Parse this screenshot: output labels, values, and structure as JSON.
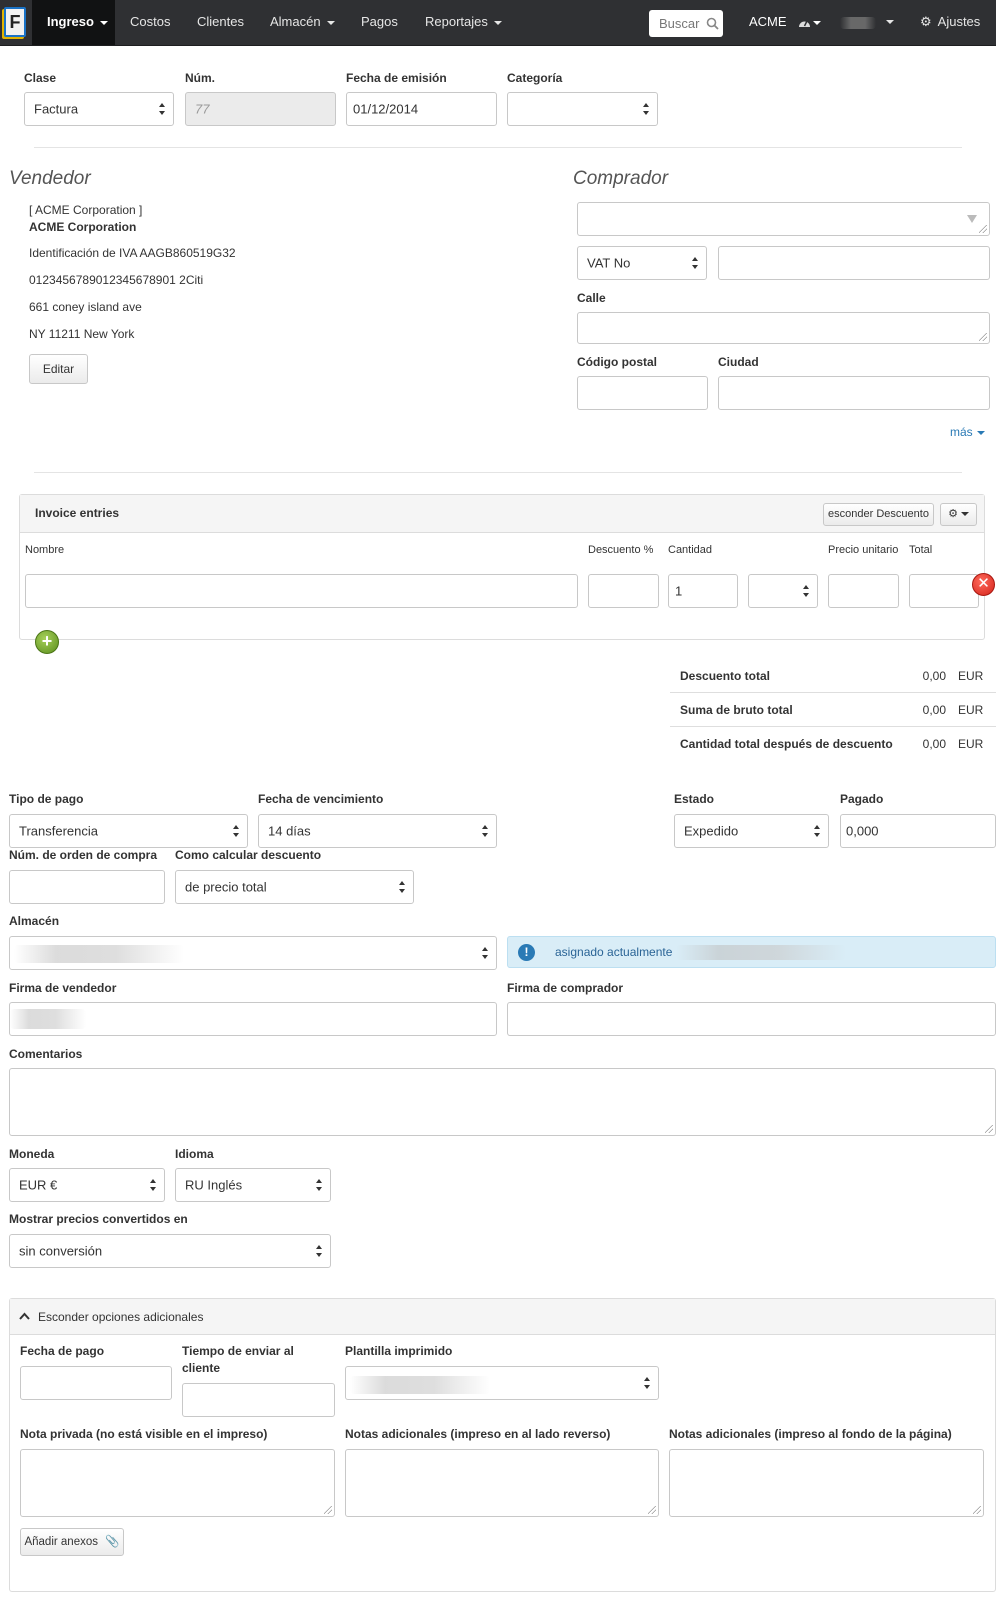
{
  "navbar": {
    "logo_letter": "F",
    "items": [
      {
        "label": "Ingreso"
      },
      {
        "label": "Costos"
      },
      {
        "label": "Clientes"
      },
      {
        "label": "Almacén"
      },
      {
        "label": "Pagos"
      },
      {
        "label": "Reportajes"
      }
    ],
    "search_placeholder": "Buscar",
    "company": "ACME",
    "settings": "Ajustes"
  },
  "header_form": {
    "clase_label": "Clase",
    "clase_value": "Factura",
    "num_label": "Núm.",
    "num_placeholder": "77",
    "fecha_label": "Fecha de emisión",
    "fecha_value": "01/12/2014",
    "categoria_label": "Categoría"
  },
  "vendedor": {
    "heading": "Vendedor",
    "bracket_name": "[ ACME Corporation ]",
    "name": "ACME Corporation",
    "vat": "Identificación de IVA AAGB860519G32",
    "bank": "0123456789012345678901 2Citi",
    "street": "661 coney island ave",
    "city": "NY 11211 New York",
    "edit_label": "Editar"
  },
  "comprador": {
    "heading": "Comprador",
    "vat_select": "VAT No",
    "calle_label": "Calle",
    "cp_label": "Código postal",
    "ciudad_label": "Ciudad",
    "more_label": "más"
  },
  "entries": {
    "title": "Invoice entries",
    "hide_discount": "esconder Descuento",
    "col_nombre": "Nombre",
    "col_descuento": "Descuento %",
    "col_cantidad": "Cantidad",
    "col_precio": "Precio unitario",
    "col_total": "Total",
    "cantidad_value": "1"
  },
  "totals": [
    {
      "label": "Descuento total",
      "value": "0,00",
      "currency": "EUR"
    },
    {
      "label": "Suma de bruto total",
      "value": "0,00",
      "currency": "EUR"
    },
    {
      "label": "Cantidad total después de descuento",
      "value": "0,00",
      "currency": "EUR"
    }
  ],
  "payment": {
    "tipo_label": "Tipo de pago",
    "tipo_value": "Transferencia",
    "venc_label": "Fecha de vencimiento",
    "venc_value": "14 días",
    "estado_label": "Estado",
    "estado_value": "Expedido",
    "pagado_label": "Pagado",
    "pagado_value": "0,000",
    "orden_label": "Núm. de orden de compra",
    "calc_label": "Como calcular descuento",
    "calc_value": "de precio total",
    "almacen_label": "Almacén",
    "asignado_text": "asignado actualmente",
    "firma_vend_label": "Firma de vendedor",
    "firma_comp_label": "Firma de comprador",
    "comentarios_label": "Comentarios",
    "moneda_label": "Moneda",
    "moneda_value": "EUR €",
    "idioma_label": "Idioma",
    "idioma_value": "RU Inglés",
    "mostrar_label": "Mostrar precios convertidos en",
    "mostrar_value": "sin conversión"
  },
  "additional": {
    "toggle_label": "Esconder opciones adicionales",
    "fecha_pago_label": "Fecha de pago",
    "tiempo_label_1": "Tiempo de enviar al",
    "tiempo_label_2": "cliente",
    "plantilla_label": "Plantilla imprimido",
    "nota_privada_label": "Nota privada (no está visible en el impreso)",
    "notas_reverso_label": "Notas adicionales (impreso en al lado reverso)",
    "notas_fondo_label": "Notas adicionales (impreso al fondo de la página)",
    "anexos_label": "Añadir anexos"
  }
}
